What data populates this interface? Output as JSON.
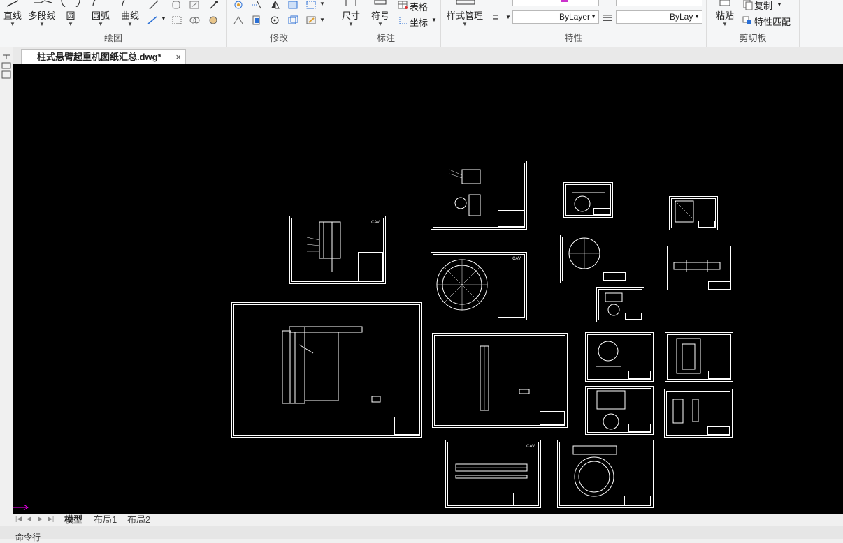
{
  "ribbon": {
    "draw": {
      "title": "绘图",
      "line": "直线",
      "polyline": "多段线",
      "circle": "圆",
      "arc": "圆弧",
      "curve": "曲线"
    },
    "modify": {
      "title": "修改"
    },
    "annotate": {
      "title": "标注",
      "dimension": "尺寸",
      "symbol": "符号",
      "table": "表格",
      "coordinate": "坐标"
    },
    "properties": {
      "title": "特性",
      "style_manager": "样式管理",
      "linetype": "ByLayer",
      "lineweight": "ByLay"
    },
    "clipboard": {
      "title": "剪切板",
      "paste": "粘贴",
      "copy": "复制",
      "match_properties": "特性匹配"
    }
  },
  "document_tab": {
    "title": "柱式悬臂起重机图纸汇总.dwg*",
    "close": "×"
  },
  "layout_tabs": [
    "模型",
    "布局1",
    "布局2"
  ],
  "command_line": {
    "label": "命令行"
  },
  "colors": {
    "canvas": "#000000",
    "drawing_lines": "#ffffff",
    "ucs_marker": "#ff00ff",
    "accent_blue": "#2a6fd6"
  }
}
